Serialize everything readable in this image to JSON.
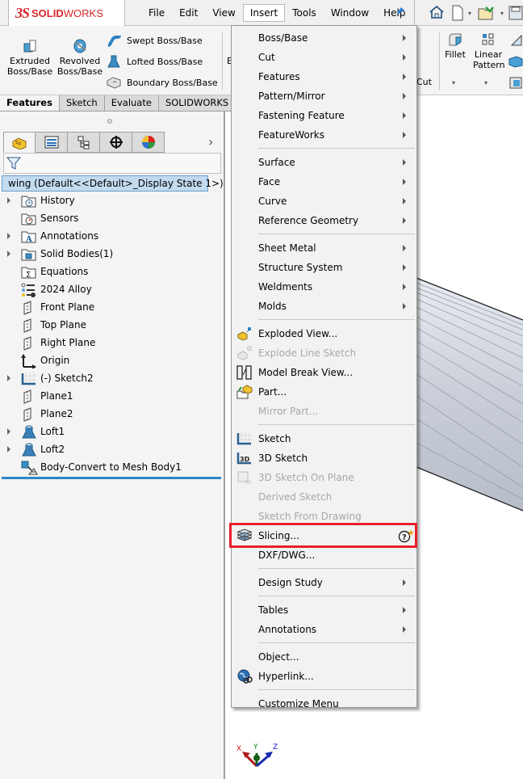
{
  "app": {
    "logo_ds": "3S",
    "logo_solid": "SOLID",
    "logo_works": "WORKS"
  },
  "menubar": {
    "items": [
      "File",
      "Edit",
      "View",
      "Insert",
      "Tools",
      "Window",
      "Help"
    ],
    "active": "Insert",
    "pin_icon": "pin-icon"
  },
  "quick_access": {
    "icons": [
      "home-icon",
      "new-document-icon",
      "open-document-icon",
      "save-icon"
    ]
  },
  "ribbon": {
    "extruded": "Extruded\nBoss/Base",
    "extruded_l1": "Extruded",
    "extruded_l2": "Boss/Base",
    "revolved_l1": "Revolved",
    "revolved_l2": "Boss/Base",
    "swept": "Swept Boss/Base",
    "lofted": "Lofted Boss/Base",
    "boundary": "Boundary Boss/Base",
    "partial_e": "E",
    "partial_cut": "Cut",
    "fillet": "Fillet",
    "linear_l1": "Linear",
    "linear_l2": "Pattern"
  },
  "command_tabs": [
    "Features",
    "Sketch",
    "Evaluate",
    "SOLIDWORKS Add"
  ],
  "feature_manager": {
    "tabs": [
      "feature-manager-tab",
      "property-manager-tab",
      "configuration-manager-tab",
      "dimxpert-tab",
      "display-manager-tab"
    ],
    "root": "wing  (Default<<Default>_Display State 1>)",
    "tree": [
      {
        "label": "History",
        "icon": "history-folder-icon",
        "expandable": true
      },
      {
        "label": "Sensors",
        "icon": "sensors-folder-icon",
        "expandable": false
      },
      {
        "label": "Annotations",
        "icon": "annotations-folder-icon",
        "expandable": true
      },
      {
        "label": "Solid Bodies(1)",
        "icon": "solid-bodies-folder-icon",
        "expandable": true
      },
      {
        "label": "Equations",
        "icon": "equations-folder-icon",
        "expandable": false
      },
      {
        "label": "2024 Alloy",
        "icon": "material-icon",
        "expandable": false
      },
      {
        "label": "Front Plane",
        "icon": "plane-icon",
        "expandable": false
      },
      {
        "label": "Top Plane",
        "icon": "plane-icon",
        "expandable": false
      },
      {
        "label": "Right Plane",
        "icon": "plane-icon",
        "expandable": false
      },
      {
        "label": "Origin",
        "icon": "origin-icon",
        "expandable": false
      },
      {
        "label": "(-) Sketch2",
        "icon": "sketch-icon",
        "expandable": true
      },
      {
        "label": "Plane1",
        "icon": "plane-icon",
        "expandable": false
      },
      {
        "label": "Plane2",
        "icon": "plane-icon",
        "expandable": false
      },
      {
        "label": "Loft1",
        "icon": "loft-icon",
        "expandable": true
      },
      {
        "label": "Loft2",
        "icon": "loft-icon",
        "expandable": true
      },
      {
        "label": "Body-Convert to Mesh Body1",
        "icon": "mesh-body-icon",
        "expandable": false
      }
    ]
  },
  "insert_menu": {
    "items": [
      {
        "label": "Boss/Base",
        "submenu": true
      },
      {
        "label": "Cut",
        "submenu": true
      },
      {
        "label": "Features",
        "submenu": true
      },
      {
        "label": "Pattern/Mirror",
        "submenu": true
      },
      {
        "label": "Fastening Feature",
        "submenu": true
      },
      {
        "label": "FeatureWorks",
        "submenu": true
      },
      {
        "label": "Surface",
        "submenu": true
      },
      {
        "label": "Face",
        "submenu": true
      },
      {
        "label": "Curve",
        "submenu": true
      },
      {
        "label": "Reference Geometry",
        "submenu": true
      },
      {
        "label": "Sheet Metal",
        "submenu": true
      },
      {
        "label": "Structure System",
        "submenu": true
      },
      {
        "label": "Weldments",
        "submenu": true
      },
      {
        "label": "Molds",
        "submenu": true
      },
      {
        "label": "Exploded View...",
        "icon": "exploded-view-icon"
      },
      {
        "label": "Explode Line Sketch",
        "icon": "explode-line-sketch-icon",
        "disabled": true
      },
      {
        "label": "Model Break View...",
        "icon": "model-break-view-icon"
      },
      {
        "label": "Part...",
        "icon": "insert-part-icon"
      },
      {
        "label": "Mirror Part...",
        "disabled": true
      },
      {
        "label": "Sketch",
        "icon": "sketch-icon"
      },
      {
        "label": "3D Sketch",
        "icon": "3d-sketch-icon"
      },
      {
        "label": "3D Sketch On Plane",
        "icon": "3d-sketch-on-plane-icon",
        "disabled": true
      },
      {
        "label": "Derived Sketch",
        "disabled": true
      },
      {
        "label": "Sketch From Drawing",
        "disabled": true
      },
      {
        "label": "Slicing...",
        "icon": "slicing-icon",
        "highlighted": true,
        "help_icon": "whats-new-help-icon"
      },
      {
        "label": "DXF/DWG..."
      },
      {
        "label": "Design Study",
        "submenu": true
      },
      {
        "label": "Tables",
        "submenu": true
      },
      {
        "label": "Annotations",
        "submenu": true
      },
      {
        "label": "Object..."
      },
      {
        "label": "Hyperlink...",
        "icon": "hyperlink-icon"
      },
      {
        "label": "Customize Menu"
      }
    ]
  },
  "triad": {
    "x": "X",
    "y": "Y",
    "z": "Z"
  },
  "colors": {
    "highlight_box": "#e8202a",
    "selection": "#c3dbef",
    "accent_blue": "#2e86c6",
    "logo_red": "#d9262b"
  }
}
